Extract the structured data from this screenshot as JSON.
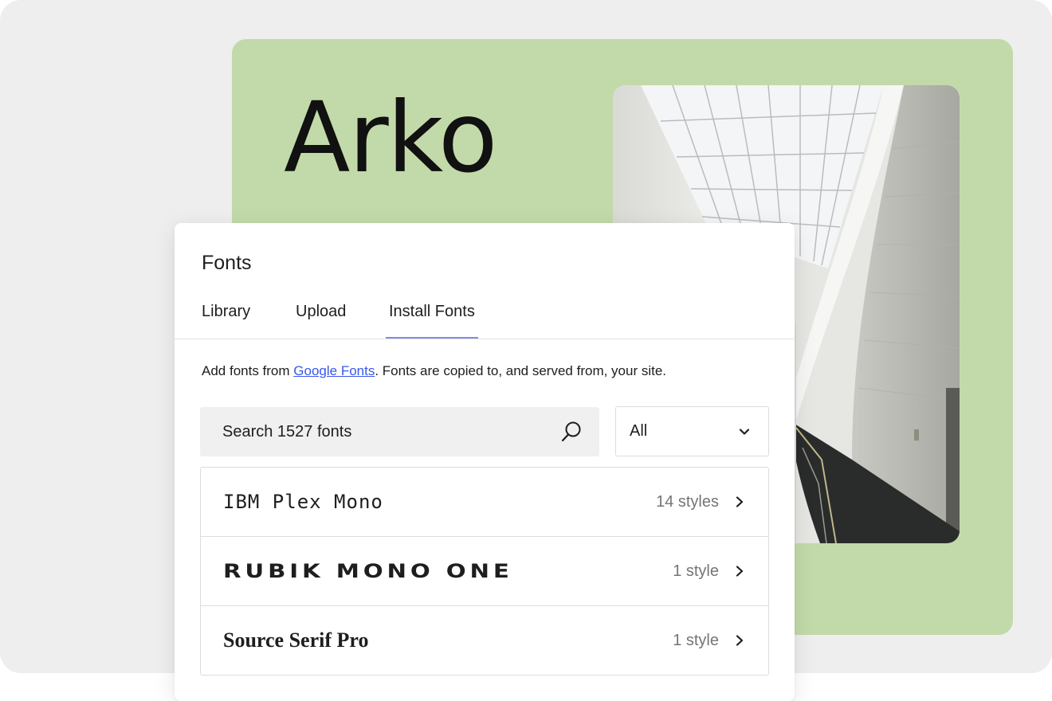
{
  "hero": {
    "title": "Arko"
  },
  "panel": {
    "title": "Fonts",
    "tabs": [
      {
        "label": "Library",
        "active": false
      },
      {
        "label": "Upload",
        "active": false
      },
      {
        "label": "Install Fonts",
        "active": true
      }
    ],
    "description": {
      "prefix": "Add fonts from ",
      "link": "Google Fonts",
      "suffix": ". Fonts are copied to, and served from, your site."
    },
    "search": {
      "placeholder": "Search 1527 fonts",
      "value": "",
      "icon": "search-icon"
    },
    "filter": {
      "selected": "All",
      "icon": "chevron-down-icon"
    },
    "fonts": [
      {
        "name": "IBM Plex Mono",
        "styles": "14 styles"
      },
      {
        "name": "RUBIK MONO ONE",
        "styles": "1 style"
      },
      {
        "name": "Source Serif Pro",
        "styles": "1 style"
      }
    ]
  },
  "colors": {
    "background": "#eeeeee",
    "green_card": "#c2daa9",
    "link": "#3858e9",
    "tab_indicator": "#7f8ce8"
  }
}
